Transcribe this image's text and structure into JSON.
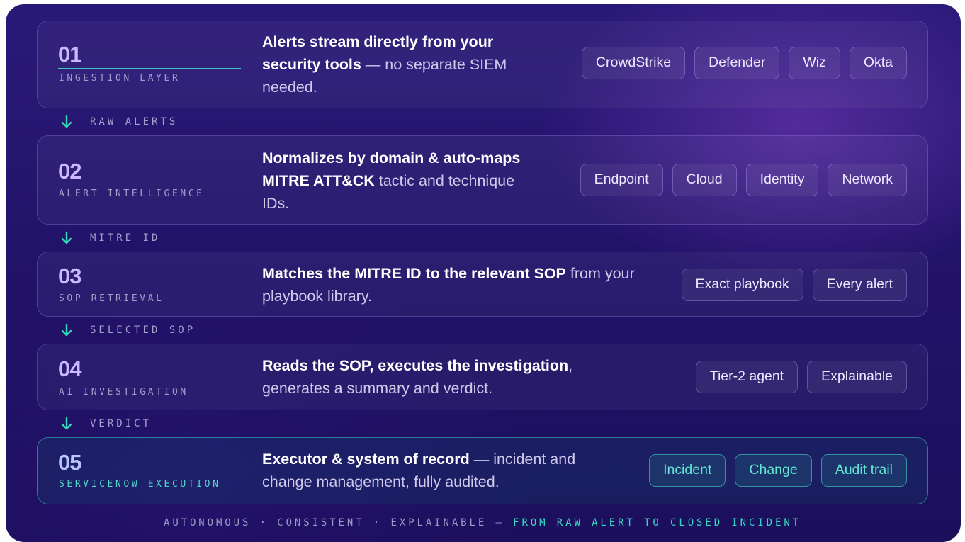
{
  "stages": [
    {
      "number": "01",
      "label": "INGESTION LAYER",
      "desc_bold": "Alerts stream directly from your security tools",
      "desc_rest": " — no separate SIEM needed.",
      "chips": [
        "CrowdStrike",
        "Defender",
        "Wiz",
        "Okta"
      ]
    },
    {
      "number": "02",
      "label": "ALERT INTELLIGENCE",
      "desc_bold": "Normalizes by domain & auto-maps MITRE ATT&CK",
      "desc_rest": " tactic and technique IDs.",
      "chips": [
        "Endpoint",
        "Cloud",
        "Identity",
        "Network"
      ]
    },
    {
      "number": "03",
      "label": "SOP RETRIEVAL",
      "desc_bold": "Matches the MITRE ID to the relevant SOP",
      "desc_rest": " from your playbook library.",
      "chips": [
        "Exact playbook",
        "Every alert"
      ]
    },
    {
      "number": "04",
      "label": "AI INVESTIGATION",
      "desc_bold": "Reads the SOP, executes the investigation",
      "desc_rest": ", generates a summary and verdict.",
      "chips": [
        "Tier-2 agent",
        "Explainable"
      ]
    },
    {
      "number": "05",
      "label": "SERVICENOW EXECUTION",
      "desc_bold": "Executor & system of record",
      "desc_rest": " — incident and change management, fully audited.",
      "chips": [
        "Incident",
        "Change",
        "Audit trail"
      ]
    }
  ],
  "connectors": [
    "RAW ALERTS",
    "MITRE ID",
    "SELECTED SOP",
    "VERDICT"
  ],
  "footer": {
    "lead": "AUTONOMOUS · CONSISTENT · EXPLAINABLE — ",
    "accent": "FROM RAW ALERT TO CLOSED INCIDENT"
  },
  "colors": {
    "accent_teal": "#38d6c2",
    "number_purple": "#c9b8ff",
    "background": "#22136a"
  }
}
